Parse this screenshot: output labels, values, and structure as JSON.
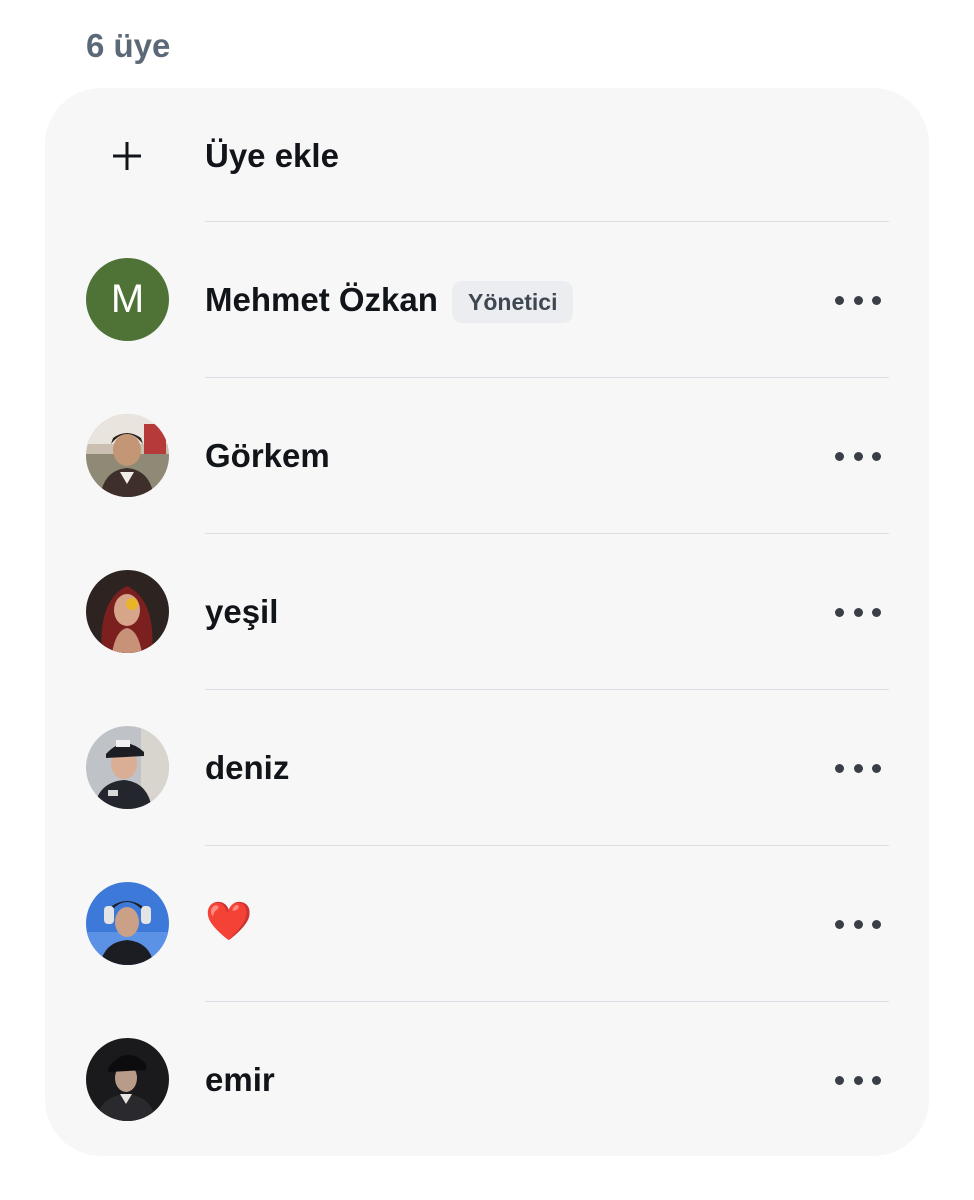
{
  "header": {
    "member_count_label": "6 üye"
  },
  "add_member": {
    "label": "Üye ekle",
    "icon": "plus-icon"
  },
  "members": [
    {
      "name": "Mehmet Özkan",
      "avatar": {
        "type": "initial",
        "initial": "M",
        "color": "#4f7336"
      },
      "badge": "Yönetici",
      "more_icon": "more-horizontal-icon"
    },
    {
      "name": "Görkem",
      "avatar": {
        "type": "photo"
      },
      "more_icon": "more-horizontal-icon"
    },
    {
      "name": "yeşil",
      "avatar": {
        "type": "photo"
      },
      "more_icon": "more-horizontal-icon"
    },
    {
      "name": "deniz",
      "avatar": {
        "type": "photo"
      },
      "more_icon": "more-horizontal-icon"
    },
    {
      "name": "❤️",
      "avatar": {
        "type": "photo"
      },
      "more_icon": "more-horizontal-icon"
    },
    {
      "name": "emir",
      "avatar": {
        "type": "photo"
      },
      "more_icon": "more-horizontal-icon"
    }
  ]
}
